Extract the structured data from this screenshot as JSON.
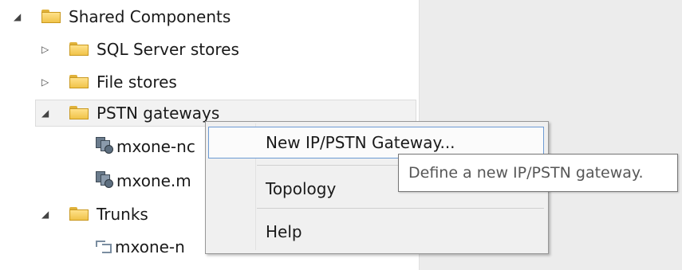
{
  "tree": {
    "root": {
      "label": "Shared Components",
      "expander": "◢"
    },
    "sql": {
      "label": "SQL Server stores",
      "expander": "▷"
    },
    "file": {
      "label": "File stores",
      "expander": "▷"
    },
    "pstn": {
      "label": "PSTN gateways",
      "expander": "◢"
    },
    "pstn_items": [
      "mxone-nc",
      "mxone.m"
    ],
    "trunks": {
      "label": "Trunks",
      "expander": "◢"
    },
    "trunk_items": [
      "mxone-n"
    ]
  },
  "context_menu": {
    "items": [
      "New IP/PSTN Gateway...",
      "Topology",
      "Help"
    ]
  },
  "tooltip": {
    "text": "Define a new IP/PSTN gateway."
  }
}
